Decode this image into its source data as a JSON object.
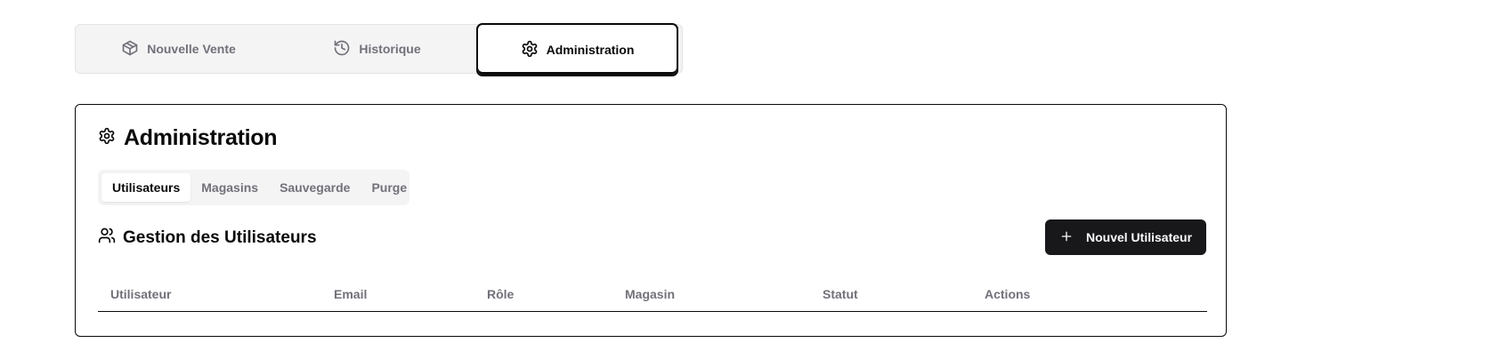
{
  "main_tabs": [
    {
      "label": "Nouvelle Vente",
      "icon": "package-icon"
    },
    {
      "label": "Historique",
      "icon": "history-icon"
    },
    {
      "label": "Administration",
      "icon": "gear-icon"
    }
  ],
  "card": {
    "title": "Administration",
    "title_icon": "gear-icon"
  },
  "sub_tabs": [
    "Utilisateurs",
    "Magasins",
    "Sauvegarde",
    "Purge"
  ],
  "users_section": {
    "title": "Gestion des Utilisateurs",
    "icon": "users-icon",
    "add_button_label": "Nouvel Utilisateur",
    "add_button_icon": "plus-icon"
  },
  "table": {
    "columns": [
      "Utilisateur",
      "Email",
      "Rôle",
      "Magasin",
      "Statut",
      "Actions"
    ]
  },
  "colors": {
    "primary": "#18181b",
    "muted_text": "#71717a",
    "tab_background": "#f4f4f5"
  }
}
